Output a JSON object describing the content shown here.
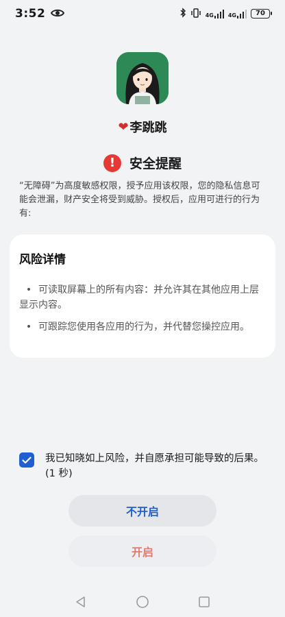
{
  "status_bar": {
    "time": "3:52",
    "network_label_1": "4G",
    "network_label_2": "4G",
    "battery": "70"
  },
  "app": {
    "name_heart": "❤",
    "name": "李跳跳"
  },
  "alert": {
    "title": "安全提醒",
    "description": "“无障碍”为高度敏感权限，授予应用该权限，您的隐私信息可能会泄漏，财产安全将受到威胁。授权后，应用可进行的行为有:"
  },
  "risk": {
    "title": "风险详情",
    "items": [
      "可读取屏幕上的所有内容：并允许其在其他应用上层显示内容。",
      "可跟踪您使用各应用的行为，并代替您操控应用。"
    ],
    "bullet": "•"
  },
  "acknowledge": {
    "checked": true,
    "text": "我已知晓如上风险，并自愿承担可能导致的后果。(1 秒)"
  },
  "buttons": {
    "cancel": "不开启",
    "enable": "开启"
  },
  "colors": {
    "accent": "#1f5fd1",
    "danger": "#e53935",
    "enable_text": "#e07b70",
    "app_icon_bg": "#2d8a57"
  }
}
